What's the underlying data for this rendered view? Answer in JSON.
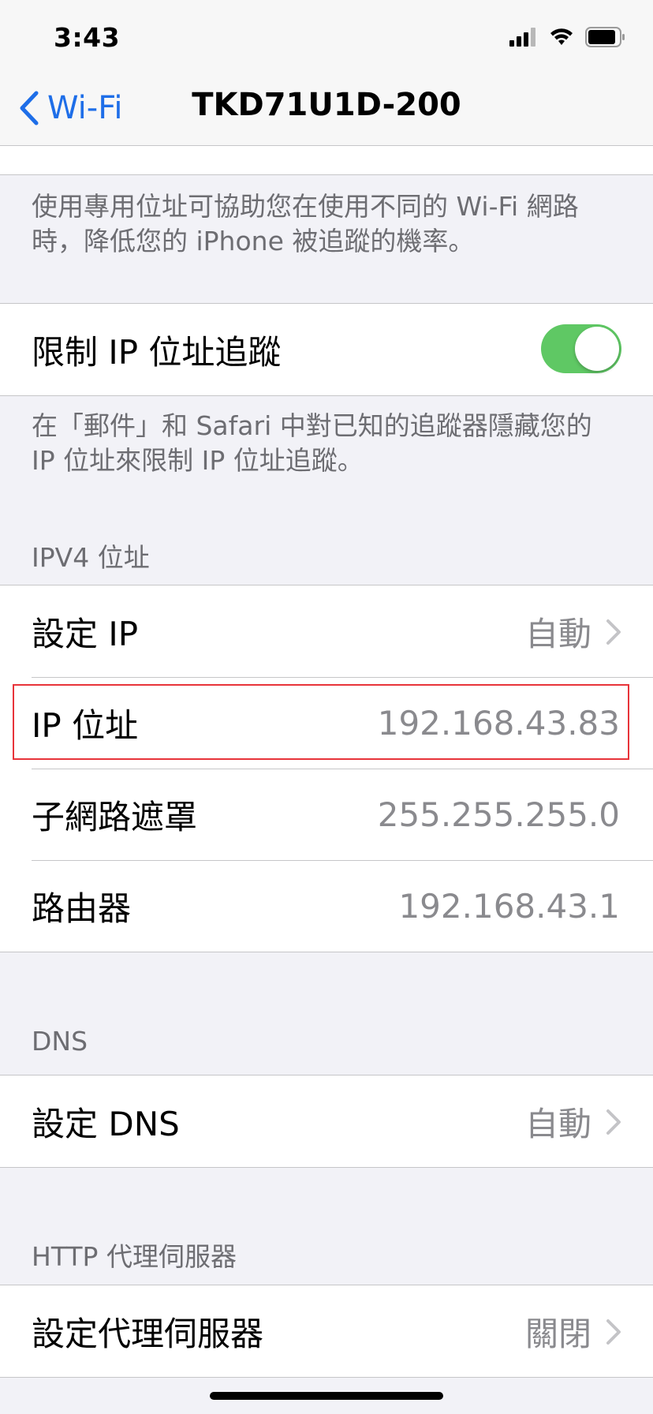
{
  "status_bar": {
    "time": "3:43"
  },
  "nav": {
    "back_label": "Wi-Fi",
    "title": "TKD71U1D-200"
  },
  "private_address_footer": "使用專用位址可協助您在使用不同的 Wi-Fi 網路時，降低您的 iPhone 被追蹤的機率。",
  "limit_ip_tracking": {
    "label": "限制 IP 位址追蹤",
    "enabled": true
  },
  "limit_ip_footer": "在「郵件」和 Safari 中對已知的追蹤器隱藏您的 IP 位址來限制 IP 位址追蹤。",
  "ipv4": {
    "header": "IPV4 位址",
    "rows": [
      {
        "label": "設定 IP",
        "value": "自動"
      },
      {
        "label": "IP 位址",
        "value": "192.168.43.83"
      },
      {
        "label": "子網路遮罩",
        "value": "255.255.255.0"
      },
      {
        "label": "路由器",
        "value": "192.168.43.1"
      }
    ]
  },
  "dns": {
    "header": "DNS",
    "label": "設定 DNS",
    "value": "自動"
  },
  "http_proxy": {
    "header": "HTTP 代理伺服器",
    "label": "設定代理伺服器",
    "value": "關閉"
  },
  "colors": {
    "accent": "#1e6ee8",
    "toggle_on": "#5fc864",
    "highlight": "#e8343a"
  }
}
